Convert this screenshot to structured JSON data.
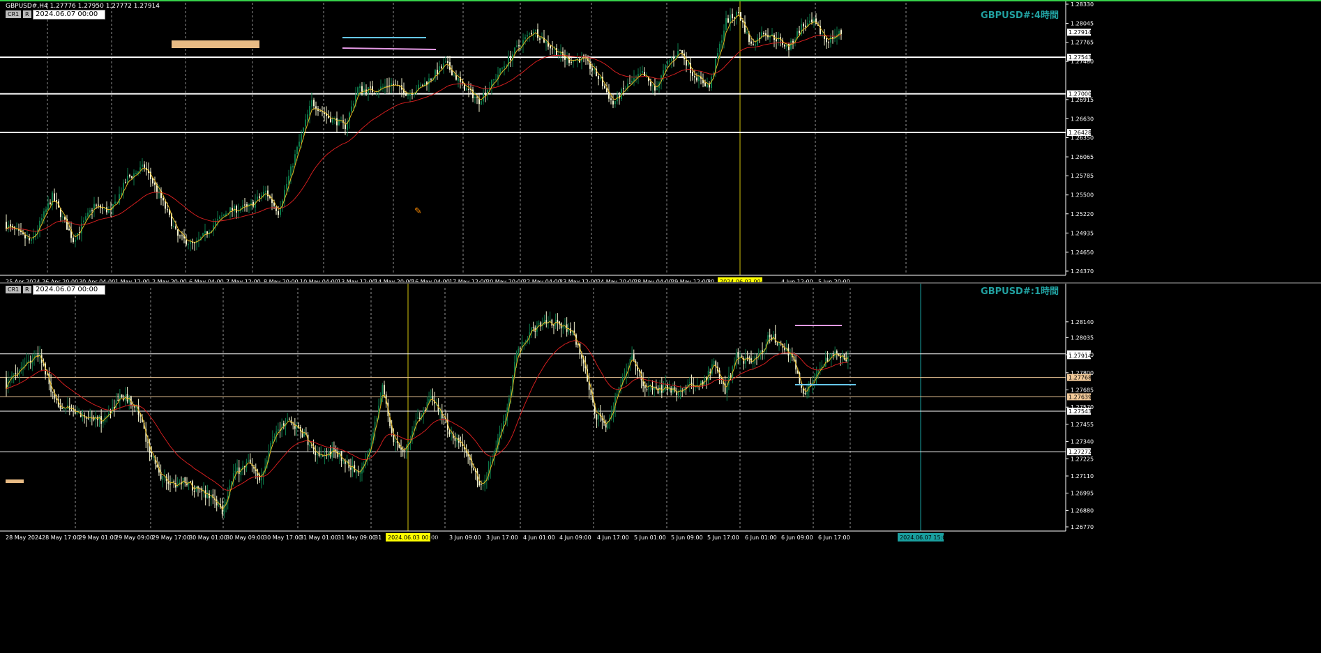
{
  "colors": {
    "grid": "#8f8f8f",
    "bull": "#0b7a4a",
    "bear": "#f5f5d0",
    "fast": "#e3b520",
    "slow": "#d21e1e",
    "hline": "#ffffff",
    "vline": "#d4c30c",
    "axis": "#ffffff"
  },
  "pane1": {
    "header": "GBPUSD#,H4  1.27776 1.27950 1.27772 1.27914",
    "badge1": "CR1",
    "badge2": "R",
    "date_box": "2024.06.07 00:00",
    "title": "GBPUSD#:4時間",
    "cursor_date": "2024.06.03 00:00",
    "icon": "pencil-cursor-icon"
  },
  "pane2": {
    "badge1": "CR1",
    "badge2": "R",
    "date_box": "2024.06.07 00:00",
    "title": "GBPUSD#:1時間",
    "cursor_date": "2024.06.03 00:00",
    "future_date": "2024.06.07 15:00"
  },
  "chart_data": [
    {
      "type": "candlestick",
      "symbol": "GBPUSD#",
      "timeframe": "H4",
      "ylim": [
        1.2437,
        1.2833
      ],
      "y_ticks": [
        1.2833,
        1.28045,
        1.27765,
        1.2748,
        1.26915,
        1.2663,
        1.2635,
        1.26065,
        1.25785,
        1.255,
        1.2522,
        1.24935,
        1.2465,
        1.2437
      ],
      "highlighted_levels": [
        1.27914,
        1.27543,
        1.27,
        1.26428
      ],
      "horizontal_lines": [
        1.27543,
        1.27,
        1.26428
      ],
      "x_tick_labels": [
        "25 Apr 2024",
        "26 Apr 20:00",
        "30 Apr 04:00",
        "1 May 12:00",
        "2 May 20:00",
        "6 May 04:00",
        "7 May 12:00",
        "8 May 20:00",
        "10 May 04:00",
        "13 May 12:00",
        "14 May 20:00",
        "16 May 04:00",
        "17 May 12:00",
        "20 May 20:00",
        "22 May 04:00",
        "23 May 12:00",
        "24 May 20:00",
        "28 May 04:00",
        "29 May 12:00",
        "30",
        "00",
        "4 Jun 12:00",
        "5 Jun 20:00"
      ],
      "last_price": 1.27914,
      "waypoints": [
        [
          0,
          1.2505
        ],
        [
          12,
          1.248
        ],
        [
          22,
          1.2548
        ],
        [
          32,
          1.2483
        ],
        [
          42,
          1.2535
        ],
        [
          50,
          1.2525
        ],
        [
          58,
          1.2575
        ],
        [
          66,
          1.2592
        ],
        [
          74,
          1.2545
        ],
        [
          82,
          1.2488
        ],
        [
          90,
          1.2475
        ],
        [
          98,
          1.2502
        ],
        [
          106,
          1.2527
        ],
        [
          116,
          1.2532
        ],
        [
          124,
          1.2555
        ],
        [
          130,
          1.2525
        ],
        [
          138,
          1.2608
        ],
        [
          146,
          1.2688
        ],
        [
          154,
          1.2665
        ],
        [
          162,
          1.2652
        ],
        [
          168,
          1.2708
        ],
        [
          176,
          1.2705
        ],
        [
          184,
          1.2715
        ],
        [
          192,
          1.27
        ],
        [
          200,
          1.2715
        ],
        [
          210,
          1.2745
        ],
        [
          218,
          1.2712
        ],
        [
          226,
          1.269
        ],
        [
          234,
          1.2725
        ],
        [
          244,
          1.2768
        ],
        [
          252,
          1.2795
        ],
        [
          260,
          1.277
        ],
        [
          268,
          1.275
        ],
        [
          276,
          1.2752
        ],
        [
          284,
          1.272
        ],
        [
          290,
          1.2685
        ],
        [
          296,
          1.271
        ],
        [
          304,
          1.273
        ],
        [
          310,
          1.2705
        ],
        [
          316,
          1.2745
        ],
        [
          322,
          1.2765
        ],
        [
          328,
          1.273
        ],
        [
          336,
          1.271
        ],
        [
          344,
          1.2808
        ],
        [
          350,
          1.282
        ],
        [
          356,
          1.2772
        ],
        [
          362,
          1.2792
        ],
        [
          368,
          1.2782
        ],
        [
          374,
          1.2768
        ],
        [
          380,
          1.28
        ],
        [
          386,
          1.2805
        ],
        [
          392,
          1.2778
        ],
        [
          398,
          1.279
        ]
      ]
    },
    {
      "type": "candlestick",
      "symbol": "GBPUSD#",
      "timeframe": "H1",
      "ylim": [
        1.2677,
        1.2833
      ],
      "y_ticks": [
        1.2814,
        1.28035,
        1.2792,
        1.278,
        1.27685,
        1.2757,
        1.27455,
        1.2734,
        1.27225,
        1.2711,
        1.26995,
        1.2688,
        1.2677
      ],
      "highlighted_levels": [
        1.27926,
        1.27914,
        1.27768,
        1.27639,
        1.27543,
        1.27272
      ],
      "horizontal_lines": [
        1.27926,
        1.27768,
        1.27639,
        1.27543,
        1.27272
      ],
      "x_tick_labels": [
        "28 May 2024",
        "28 May 17:00",
        "29 May 01:00",
        "29 May 09:00",
        "29 May 17:00",
        "30 May 01:00",
        "30 May 09:00",
        "30 May 17:00",
        "31 May 01:00",
        "31 May 09:00",
        "31",
        "00",
        "3 Jun 09:00",
        "3 Jun 17:00",
        "4 Jun 01:00",
        "4 Jun 09:00",
        "4 Jun 17:00",
        "5 Jun 01:00",
        "5 Jun 09:00",
        "5 Jun 17:00",
        "6 Jun 01:00",
        "6 Jun 09:00",
        "6 Jun 17:00"
      ],
      "last_price": 1.27914,
      "waypoints": [
        [
          0,
          1.2772
        ],
        [
          10,
          1.2787
        ],
        [
          18,
          1.2792
        ],
        [
          26,
          1.276
        ],
        [
          40,
          1.2752
        ],
        [
          52,
          1.2748
        ],
        [
          62,
          1.2765
        ],
        [
          70,
          1.2758
        ],
        [
          76,
          1.2732
        ],
        [
          82,
          1.2712
        ],
        [
          90,
          1.2705
        ],
        [
          96,
          1.2708
        ],
        [
          104,
          1.27
        ],
        [
          110,
          1.2698
        ],
        [
          116,
          1.2688
        ],
        [
          122,
          1.2712
        ],
        [
          130,
          1.272
        ],
        [
          136,
          1.2708
        ],
        [
          144,
          1.274
        ],
        [
          152,
          1.2748
        ],
        [
          160,
          1.2738
        ],
        [
          168,
          1.2722
        ],
        [
          176,
          1.2728
        ],
        [
          184,
          1.2718
        ],
        [
          190,
          1.2712
        ],
        [
          196,
          1.2735
        ],
        [
          202,
          1.277
        ],
        [
          208,
          1.2735
        ],
        [
          214,
          1.2728
        ],
        [
          222,
          1.2752
        ],
        [
          228,
          1.2762
        ],
        [
          234,
          1.2752
        ],
        [
          240,
          1.2735
        ],
        [
          246,
          1.273
        ],
        [
          252,
          1.2712
        ],
        [
          256,
          1.2703
        ],
        [
          262,
          1.2728
        ],
        [
          268,
          1.275
        ],
        [
          274,
          1.2792
        ],
        [
          282,
          1.2808
        ],
        [
          290,
          1.2815
        ],
        [
          298,
          1.2812
        ],
        [
          304,
          1.2806
        ],
        [
          310,
          1.2787
        ],
        [
          316,
          1.2752
        ],
        [
          322,
          1.2745
        ],
        [
          330,
          1.2772
        ],
        [
          336,
          1.2792
        ],
        [
          342,
          1.2772
        ],
        [
          348,
          1.2768
        ],
        [
          354,
          1.277
        ],
        [
          360,
          1.2767
        ],
        [
          368,
          1.2772
        ],
        [
          374,
          1.2772
        ],
        [
          380,
          1.2787
        ],
        [
          386,
          1.2768
        ],
        [
          392,
          1.2792
        ],
        [
          398,
          1.2787
        ],
        [
          404,
          1.279
        ],
        [
          410,
          1.2805
        ],
        [
          416,
          1.2798
        ],
        [
          422,
          1.279
        ],
        [
          428,
          1.2765
        ],
        [
          434,
          1.2776
        ],
        [
          440,
          1.2788
        ],
        [
          446,
          1.2792
        ],
        [
          452,
          1.279
        ]
      ]
    }
  ]
}
